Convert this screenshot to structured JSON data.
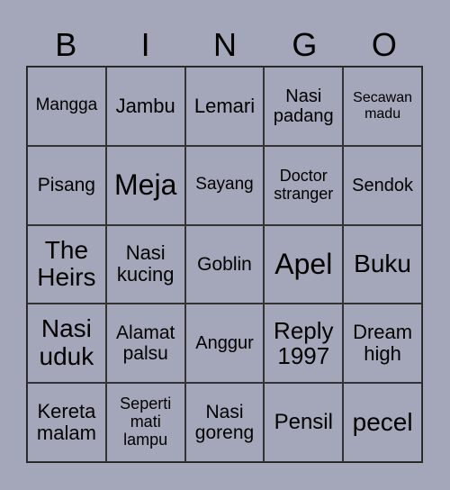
{
  "header": [
    "B",
    "I",
    "N",
    "G",
    "O"
  ],
  "cells": [
    [
      {
        "t": "Mangga",
        "s": 19
      },
      {
        "t": "Jambu",
        "s": 22
      },
      {
        "t": "Lemari",
        "s": 22
      },
      {
        "t": "Nasi padang",
        "s": 20
      },
      {
        "t": "Secawan madu",
        "s": 16
      }
    ],
    [
      {
        "t": "Pisang",
        "s": 21
      },
      {
        "t": "Meja",
        "s": 32
      },
      {
        "t": "Sayang",
        "s": 19
      },
      {
        "t": "Doctor stranger",
        "s": 18
      },
      {
        "t": "Sendok",
        "s": 20
      }
    ],
    [
      {
        "t": "The Heirs",
        "s": 28
      },
      {
        "t": "Nasi kucing",
        "s": 22
      },
      {
        "t": "Goblin",
        "s": 21
      },
      {
        "t": "Apel",
        "s": 32
      },
      {
        "t": "Buku",
        "s": 28
      }
    ],
    [
      {
        "t": "Nasi uduk",
        "s": 28
      },
      {
        "t": "Alamat palsu",
        "s": 21
      },
      {
        "t": "Anggur",
        "s": 20
      },
      {
        "t": "Reply 1997",
        "s": 26
      },
      {
        "t": "Dream high",
        "s": 22
      }
    ],
    [
      {
        "t": "Kereta malam",
        "s": 22
      },
      {
        "t": "Seperti mati lampu",
        "s": 18
      },
      {
        "t": "Nasi goreng",
        "s": 21
      },
      {
        "t": "Pensil",
        "s": 24
      },
      {
        "t": "pecel",
        "s": 28
      }
    ]
  ]
}
